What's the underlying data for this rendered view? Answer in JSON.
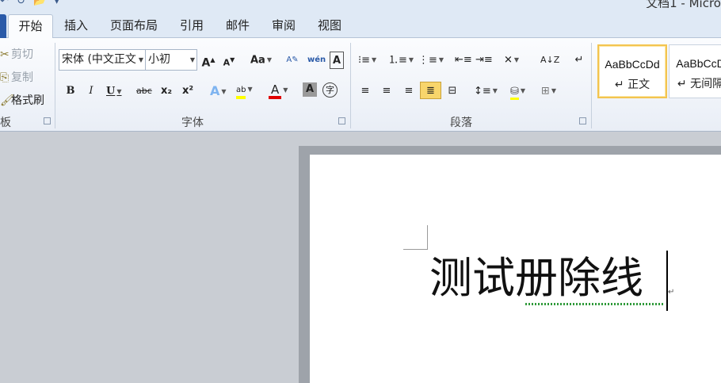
{
  "window": {
    "title": "文档1 - Micro",
    "quick_access": [
      "↶",
      "↻",
      "📂",
      "▾"
    ]
  },
  "tabs": [
    "开始",
    "插入",
    "页面布局",
    "引用",
    "邮件",
    "审阅",
    "视图"
  ],
  "clipboard": {
    "cut": "剪切",
    "copy": "复制",
    "format_painter": "格式刷",
    "group_label": "板"
  },
  "font": {
    "family": "宋体 (中文正文",
    "size": "小初",
    "grow": "A",
    "shrink": "A",
    "case": "Aa",
    "phonetic": "wén",
    "char_border": "A",
    "bold": "B",
    "italic": "I",
    "underline": "U",
    "strike": "abc",
    "subscript": "x₂",
    "superscript": "x²",
    "text_effect": "A",
    "highlight": "ab",
    "font_color": "A",
    "char_shading": "A",
    "enclose": "字",
    "group_label": "字体"
  },
  "paragraph": {
    "group_label": "段落"
  },
  "styles": {
    "normal_sample": "AaBbCcDd",
    "normal_name": "↵ 正文",
    "nospace_sample": "AaBbCcD",
    "nospace_name": "↵ 无间隔"
  },
  "document": {
    "text": "测试册除线",
    "para_mark": "↵"
  },
  "colors": {
    "highlight_bar": "#ffff00",
    "font_color_bar": "#e00000",
    "accent_tab": "#2a5aa8"
  }
}
